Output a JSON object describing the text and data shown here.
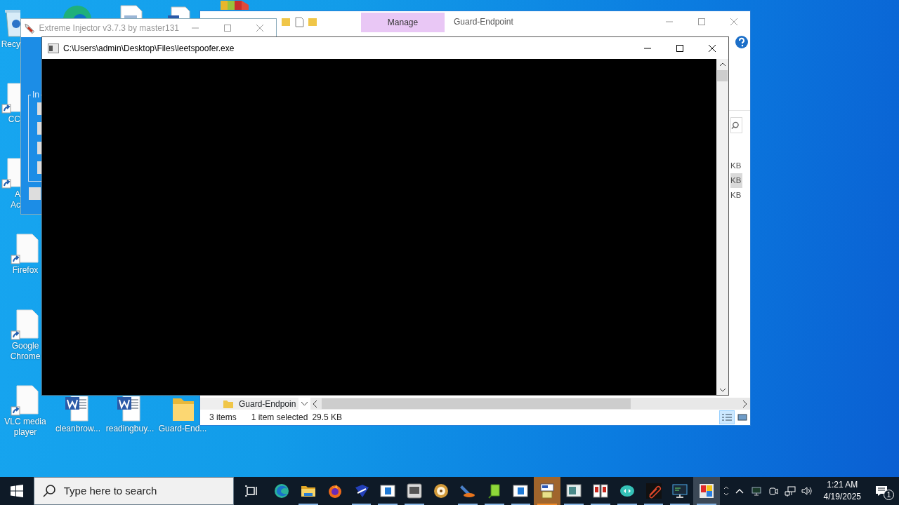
{
  "desktop_icons": [
    {
      "kind": "recycle",
      "lines": [
        "Recy"
      ]
    },
    {
      "kind": "shortcut",
      "lines": [
        "CC"
      ]
    },
    {
      "kind": "shortcut",
      "lines": [
        "A",
        "Ac"
      ]
    },
    {
      "kind": "shortcut",
      "lines": [
        "Firefox"
      ]
    },
    {
      "kind": "shortcut",
      "lines": [
        "Google",
        "Chrome"
      ]
    },
    {
      "kind": "shortcut",
      "lines": [
        "VLC media",
        "player"
      ]
    },
    {
      "kind": "word",
      "lines": [
        "cleanbrow..."
      ]
    },
    {
      "kind": "word",
      "lines": [
        "readingbuy..."
      ]
    },
    {
      "kind": "folder",
      "lines": [
        "Guard-End..."
      ]
    }
  ],
  "explorer": {
    "active": false,
    "context_tab": {
      "label": "Manage",
      "selected": true
    },
    "title": "Guard-Endpoint",
    "files": [
      {
        "size": "KB",
        "selected": false
      },
      {
        "size": "KB",
        "selected": true
      },
      {
        "size": "KB",
        "selected": false
      }
    ],
    "nav_item": "Guard-Endpoin",
    "status": {
      "count": "3 items",
      "selection": "1 item selected",
      "size": "29.5 KB"
    },
    "views": [
      {
        "kind": "details",
        "selected": true
      },
      {
        "kind": "large",
        "selected": false
      }
    ]
  },
  "injector": {
    "active": false,
    "title": "Extreme Injector v3.7.3 by master131",
    "group_label": "In"
  },
  "console": {
    "active": true,
    "title": "C:\\Users\\admin\\Desktop\\Files\\leetspoofer.exe"
  },
  "taskbar": {
    "search": {
      "placeholder": "Type here to search"
    },
    "apps": [
      {
        "kind": "globe",
        "running": false,
        "flashing": false,
        "selected": false
      },
      {
        "kind": "folder",
        "running": true,
        "flashing": false,
        "selected": false
      },
      {
        "kind": "flame",
        "running": false,
        "flashing": false,
        "selected": false
      },
      {
        "kind": "swoosh",
        "running": true,
        "flashing": false,
        "selected": false
      },
      {
        "kind": "window",
        "running": true,
        "flashing": false,
        "selected": false
      },
      {
        "kind": "plate",
        "running": true,
        "flashing": false,
        "selected": false
      },
      {
        "kind": "disc",
        "running": false,
        "flashing": false,
        "selected": false
      },
      {
        "kind": "tool",
        "running": true,
        "flashing": false,
        "selected": false
      },
      {
        "kind": "leaf",
        "running": true,
        "flashing": false,
        "selected": false
      },
      {
        "kind": "window",
        "running": true,
        "flashing": false,
        "selected": false
      },
      {
        "kind": "setup",
        "running": true,
        "flashing": true,
        "selected": false
      },
      {
        "kind": "panel",
        "running": true,
        "flashing": false,
        "selected": false
      },
      {
        "kind": "calendar",
        "running": true,
        "flashing": false,
        "selected": false
      },
      {
        "kind": "cloud",
        "running": true,
        "flashing": false,
        "selected": false
      },
      {
        "kind": "clip",
        "running": true,
        "flashing": false,
        "selected": false
      },
      {
        "kind": "monitor",
        "running": true,
        "flashing": false,
        "selected": false
      },
      {
        "kind": "tiles",
        "running": true,
        "flashing": false,
        "selected": true
      }
    ],
    "clock": {
      "time": "1:21 AM",
      "date": "4/19/2025"
    },
    "notifications": "1"
  }
}
